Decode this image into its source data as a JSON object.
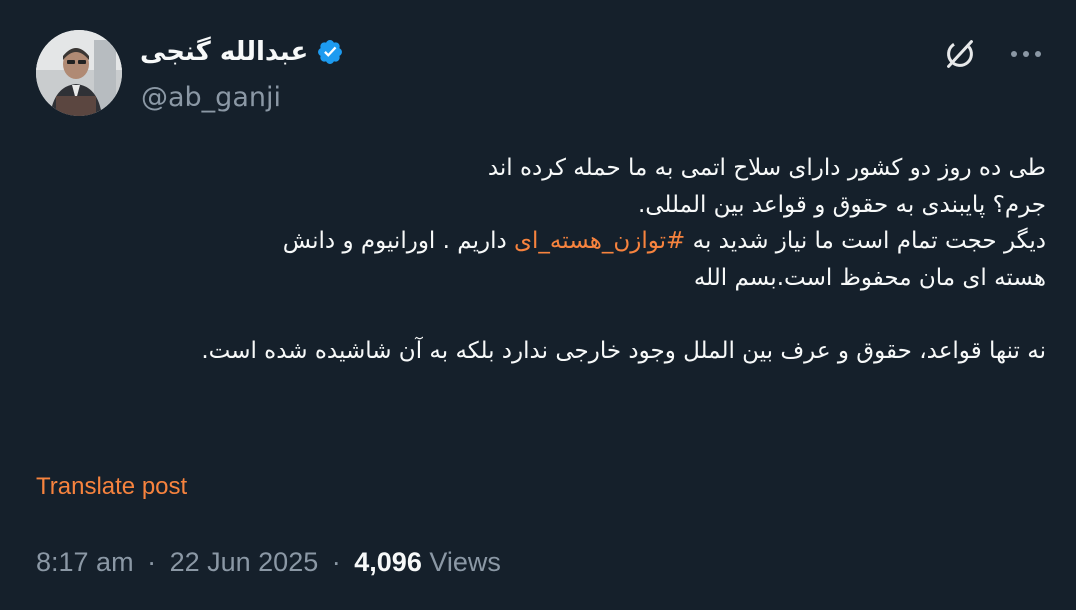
{
  "author": {
    "display_name": "عبدالله گنجی",
    "handle": "@ab_ganji",
    "verified": true,
    "verified_color": "#1d9bf0"
  },
  "icons": {
    "avatar": "profile-photo",
    "verified": "verified-badge-icon",
    "grok": "grok-icon",
    "more": "more-options-icon"
  },
  "tweet": {
    "lines": [
      "طی ده روز دو کشور دارای سلاح اتمی به ما حمله کرده اند",
      "جرم؟ پایبندی به حقوق و قواعد بین المللی.",
      "دیگر حجت تمام است ما نیاز شدید به ",
      "هسته ای مان محفوظ است.بسم الله",
      "نه تنها قواعد، حقوق  و  عرف بین الملل وجود خارجی ندارد بلکه به آن شاشیده شده است."
    ],
    "hashtag": "#توازن_هسته_ای",
    "line3_suffix": " داریم . اورانیوم و دانش"
  },
  "translate_label": "Translate post",
  "meta": {
    "time": "8:17 am",
    "date": "22 Jun 2025",
    "views_count": "4,096",
    "views_label": "Views",
    "separator": "·"
  },
  "colors": {
    "background": "#15202b",
    "text": "#f7f9f9",
    "muted": "#8b98a5",
    "accent": "#f7833e"
  }
}
